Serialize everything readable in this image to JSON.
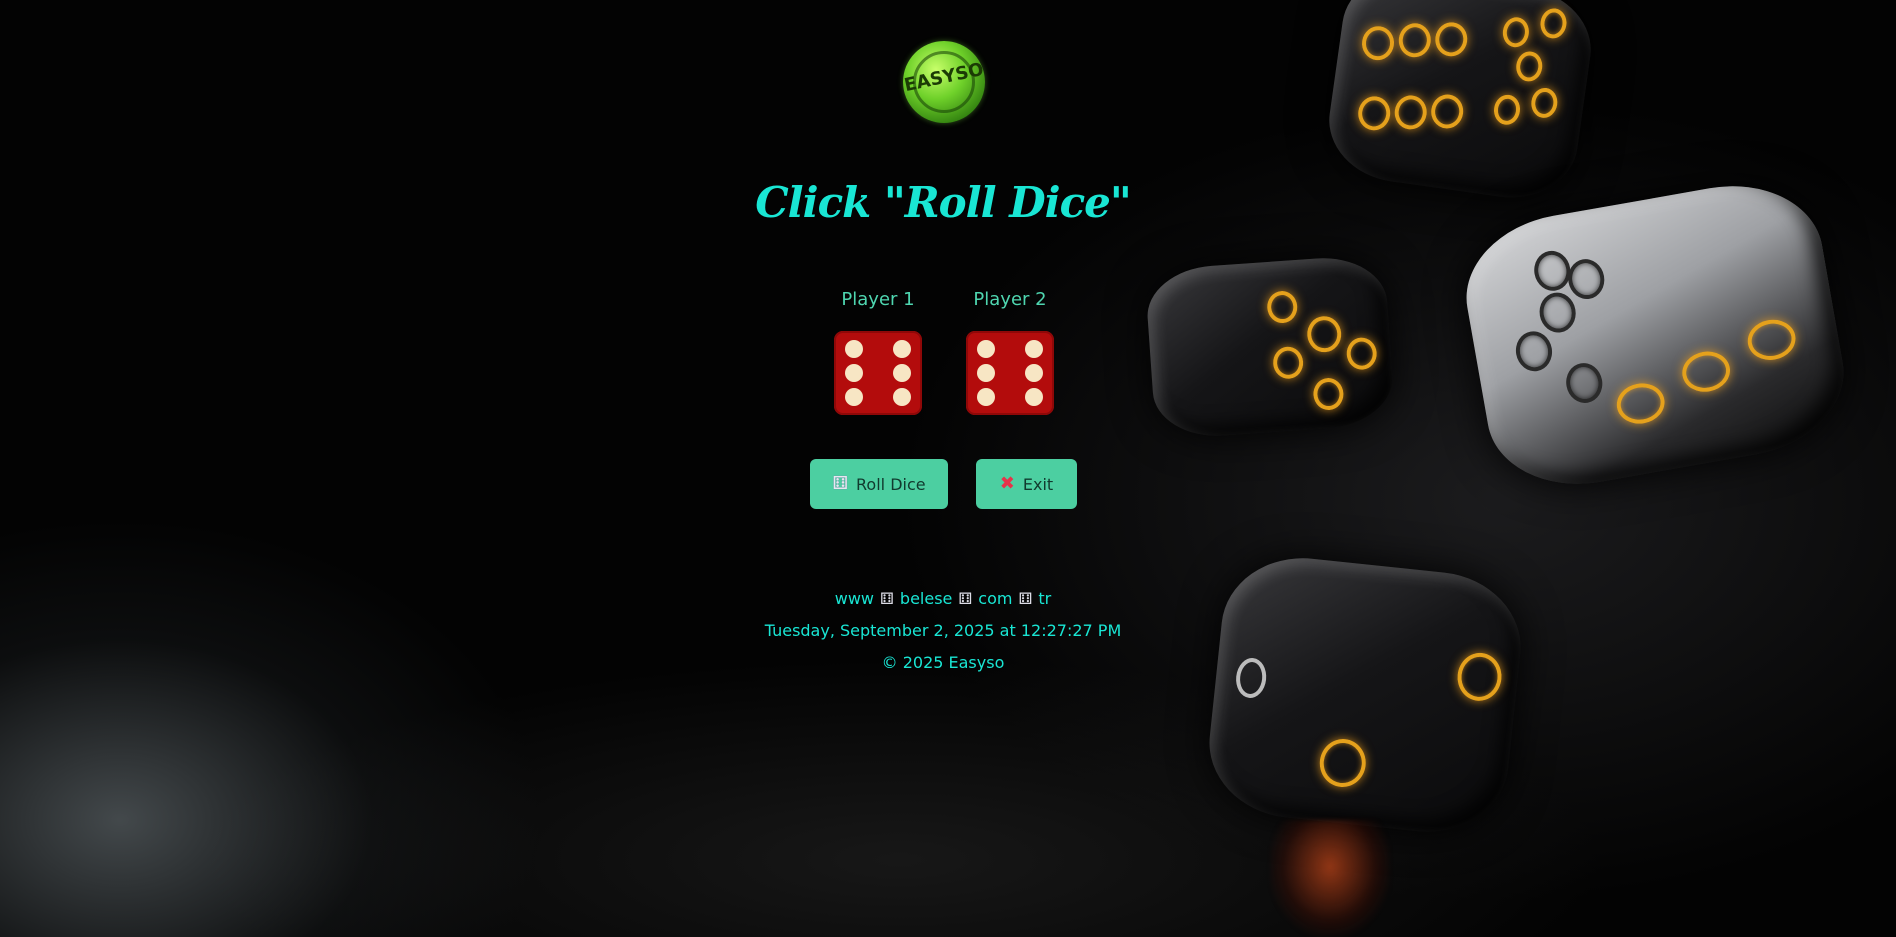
{
  "logo": {
    "text": "EASYSO"
  },
  "title": "Click \"Roll Dice\"",
  "players": [
    {
      "label": "Player 1",
      "die_value": 6
    },
    {
      "label": "Player 2",
      "die_value": 6
    }
  ],
  "buttons": {
    "roll": {
      "icon": "dice-icon",
      "label": "Roll Dice"
    },
    "exit": {
      "icon": "cross-mark-icon",
      "label": "Exit"
    }
  },
  "footer": {
    "site_parts": [
      "www",
      "belese",
      "com",
      "tr"
    ],
    "datetime": "Tuesday, September 2, 2025 at 12:27:27 PM",
    "copyright": "© 2025 Easyso"
  },
  "colors": {
    "title": "#19e6d4",
    "player_label": "#4fd6b0",
    "die_face": "#b30c0c",
    "pip": "#f7e6c4",
    "button": "#4ccfa1"
  }
}
